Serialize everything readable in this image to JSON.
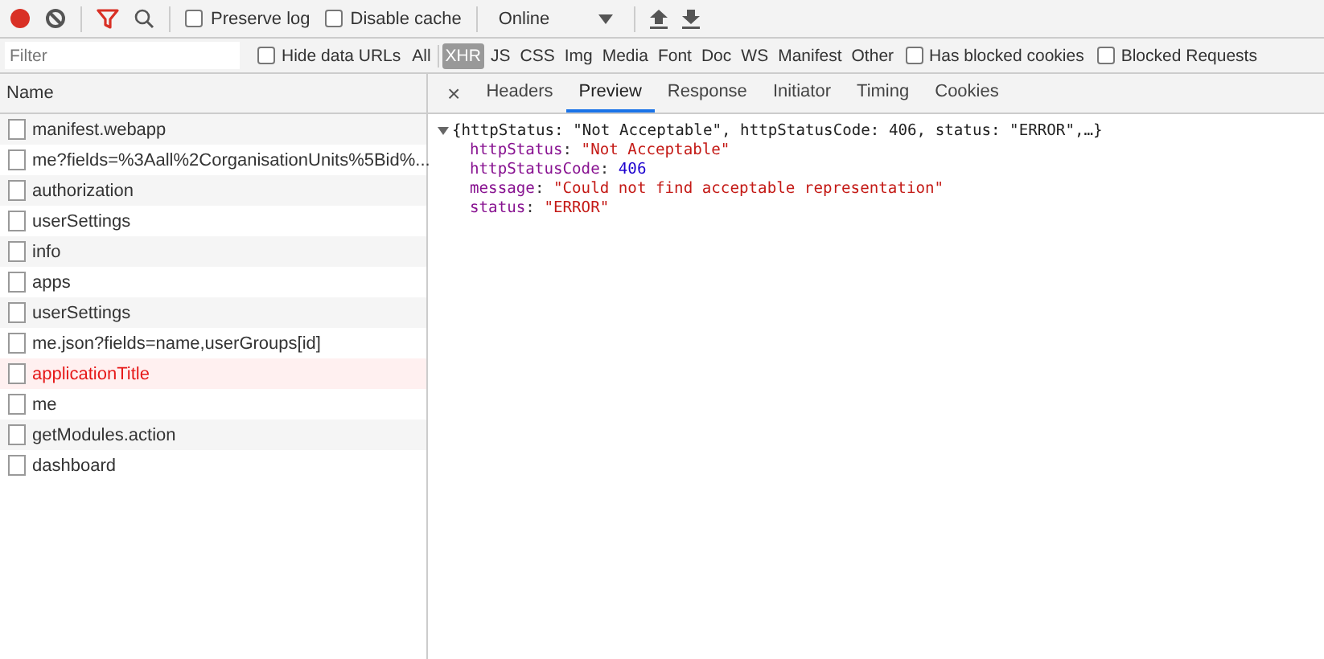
{
  "toolbar": {
    "recording": true,
    "preserve_log": {
      "label": "Preserve log",
      "checked": false
    },
    "disable_cache": {
      "label": "Disable cache",
      "checked": false
    },
    "throttling": "Online"
  },
  "filter_bar": {
    "placeholder": "Filter",
    "hide_data_urls": {
      "label": "Hide data URLs",
      "checked": false
    },
    "types": [
      {
        "label": "All",
        "selected": false
      },
      {
        "label": "XHR",
        "selected": true
      },
      {
        "label": "JS",
        "selected": false
      },
      {
        "label": "CSS",
        "selected": false
      },
      {
        "label": "Img",
        "selected": false
      },
      {
        "label": "Media",
        "selected": false
      },
      {
        "label": "Font",
        "selected": false
      },
      {
        "label": "Doc",
        "selected": false
      },
      {
        "label": "WS",
        "selected": false
      },
      {
        "label": "Manifest",
        "selected": false
      },
      {
        "label": "Other",
        "selected": false
      }
    ],
    "has_blocked_cookies": {
      "label": "Has blocked cookies",
      "checked": false
    },
    "blocked_requests": {
      "label": "Blocked Requests",
      "checked": false
    }
  },
  "requests": {
    "column": "Name",
    "rows": [
      {
        "name": "manifest.webapp",
        "error": false
      },
      {
        "name": "me?fields=%3Aall%2CorganisationUnits%5Bid%...",
        "error": false
      },
      {
        "name": "authorization",
        "error": false
      },
      {
        "name": "userSettings",
        "error": false
      },
      {
        "name": "info",
        "error": false
      },
      {
        "name": "apps",
        "error": false
      },
      {
        "name": "userSettings",
        "error": false
      },
      {
        "name": "me.json?fields=name,userGroups[id]",
        "error": false
      },
      {
        "name": "applicationTitle",
        "error": true
      },
      {
        "name": "me",
        "error": false
      },
      {
        "name": "getModules.action",
        "error": false
      },
      {
        "name": "dashboard",
        "error": false
      }
    ]
  },
  "detail": {
    "close": "×",
    "tabs": [
      {
        "label": "Headers",
        "selected": false
      },
      {
        "label": "Preview",
        "selected": true
      },
      {
        "label": "Response",
        "selected": false
      },
      {
        "label": "Initiator",
        "selected": false
      },
      {
        "label": "Timing",
        "selected": false
      },
      {
        "label": "Cookies",
        "selected": false
      }
    ],
    "preview": {
      "expanded": true,
      "summary": "{httpStatus: \"Not Acceptable\", httpStatusCode: 406, status: \"ERROR\",…}",
      "properties": [
        {
          "key": "httpStatus",
          "separator": ":",
          "value": "\"Not Acceptable\"",
          "kind": "string"
        },
        {
          "key": "httpStatusCode",
          "separator": ":",
          "value": "406",
          "kind": "number"
        },
        {
          "key": "message",
          "separator": ":",
          "value": "\"Could not find acceptable representation\"",
          "kind": "string"
        },
        {
          "key": "status",
          "separator": ":",
          "value": "\"ERROR\"",
          "kind": "string"
        }
      ]
    }
  }
}
